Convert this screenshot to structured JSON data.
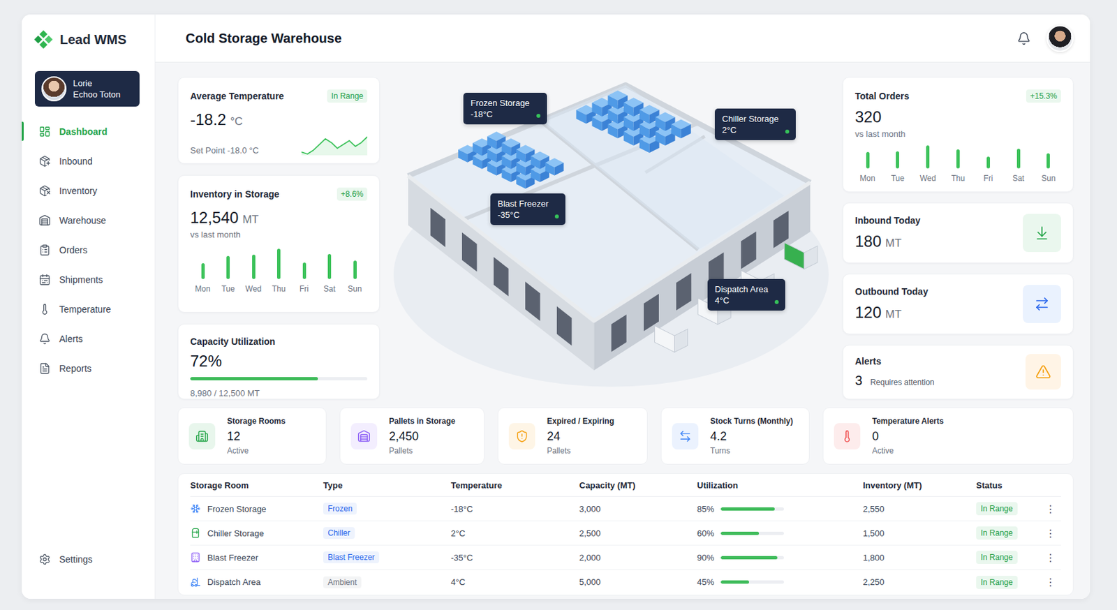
{
  "brand": {
    "name": "Lead WMS"
  },
  "user": {
    "first_name": "Lorie",
    "last_name": "Echoo Toton"
  },
  "sidebar": {
    "items": [
      {
        "label": "Dashboard",
        "selected": true
      },
      {
        "label": "Inbound",
        "selected": false
      },
      {
        "label": "Inventory",
        "selected": false
      },
      {
        "label": "Warehouse",
        "selected": false
      },
      {
        "label": "Orders",
        "selected": false
      },
      {
        "label": "Shipments",
        "selected": false
      },
      {
        "label": "Temperature",
        "selected": false
      },
      {
        "label": "Alerts",
        "selected": false
      },
      {
        "label": "Reports",
        "selected": false
      }
    ],
    "footer": {
      "label": "Settings",
      "selected": false
    }
  },
  "header": {
    "title": "Cold Storage Warehouse"
  },
  "avg_temp": {
    "title": "Average Temperature",
    "badge": "In Range",
    "value": "-18.2",
    "unit": "°C",
    "set_point": "Set Point -18.0 °C",
    "trend": [
      2,
      1,
      3,
      6,
      9,
      7,
      4,
      6,
      8,
      5,
      7,
      10
    ]
  },
  "inventory": {
    "title": "Inventory in Storage",
    "badge": "+8.6%",
    "value": "12,540",
    "unit": "MT",
    "caption": "vs last month",
    "days": [
      "Mon",
      "Tue",
      "Wed",
      "Thu",
      "Fri",
      "Sat",
      "Sun"
    ],
    "values": [
      22,
      33,
      35,
      43,
      23,
      36,
      26
    ]
  },
  "capacity": {
    "title": "Capacity Utilization",
    "value": "72%",
    "level": 0.72,
    "caption": "8,980 / 12,500 MT"
  },
  "map": {
    "labels": [
      {
        "name": "Frozen Storage",
        "temp": "-18°C"
      },
      {
        "name": "Chiller Storage",
        "temp": "2°C"
      },
      {
        "name": "Blast Freezer",
        "temp": "-35°C"
      },
      {
        "name": "Dispatch Area",
        "temp": "4°C"
      }
    ]
  },
  "total_orders": {
    "title": "Total Orders",
    "badge": "+15.3%",
    "value": "320",
    "caption": "vs last month",
    "days": [
      "Mon",
      "Tue",
      "Wed",
      "Thu",
      "Fri",
      "Sat",
      "Sun"
    ],
    "values": [
      24,
      25,
      33,
      27,
      17,
      28,
      22
    ]
  },
  "inbound": {
    "title": "Inbound Today",
    "value": "180",
    "unit": "MT"
  },
  "outbound": {
    "title": "Outbound Today",
    "value": "120",
    "unit": "MT"
  },
  "alerts": {
    "title": "Alerts",
    "value": "3",
    "caption": "Requires attention"
  },
  "stats": [
    {
      "title": "Storage Rooms",
      "value": "12",
      "caption": "Active",
      "color": "#22a447"
    },
    {
      "title": "Pallets in Storage",
      "value": "2,450",
      "caption": "Pallets",
      "color": "#8b5cf6"
    },
    {
      "title": "Expired / Expiring",
      "value": "24",
      "caption": "Pallets",
      "color": "#f59e0b"
    },
    {
      "title": "Stock Turns (Monthly)",
      "value": "4.2",
      "caption": "Turns",
      "color": "#3b82f6"
    },
    {
      "title": "Temperature Alerts",
      "value": "0",
      "caption": "Active",
      "color": "#ef4444"
    }
  ],
  "table": {
    "columns": [
      "Storage Room",
      "Type",
      "Temperature",
      "Capacity (MT)",
      "Utilization",
      "Inventory (MT)",
      "Status"
    ],
    "rows": [
      {
        "room": "Frozen Storage",
        "type": "Frozen",
        "temperature": "-18°C",
        "capacity": "3,000",
        "utilization": "85%",
        "level": 0.85,
        "inventory": "2,550",
        "status": "In Range",
        "menu": "⋮",
        "color": "#2563eb",
        "icon_color": "#3b82f6"
      },
      {
        "room": "Chiller Storage",
        "type": "Chiller",
        "temperature": "2°C",
        "capacity": "2,500",
        "utilization": "60%",
        "level": 0.6,
        "inventory": "1,500",
        "status": "In Range",
        "menu": "⋮",
        "color": "#2563eb",
        "icon_color": "#22a447"
      },
      {
        "room": "Blast Freezer",
        "type": "Blast Freezer",
        "temperature": "-35°C",
        "capacity": "2,000",
        "utilization": "90%",
        "level": 0.9,
        "inventory": "1,800",
        "status": "In Range",
        "menu": "⋮",
        "color": "#2563eb",
        "icon_color": "#8b5cf6"
      },
      {
        "room": "Dispatch Area",
        "type": "Ambient",
        "temperature": "4°C",
        "capacity": "5,000",
        "utilization": "45%",
        "level": 0.45,
        "inventory": "2,250",
        "status": "In Range",
        "menu": "⋮",
        "color": "#6b7280",
        "icon_color": "#3b82f6"
      }
    ]
  }
}
